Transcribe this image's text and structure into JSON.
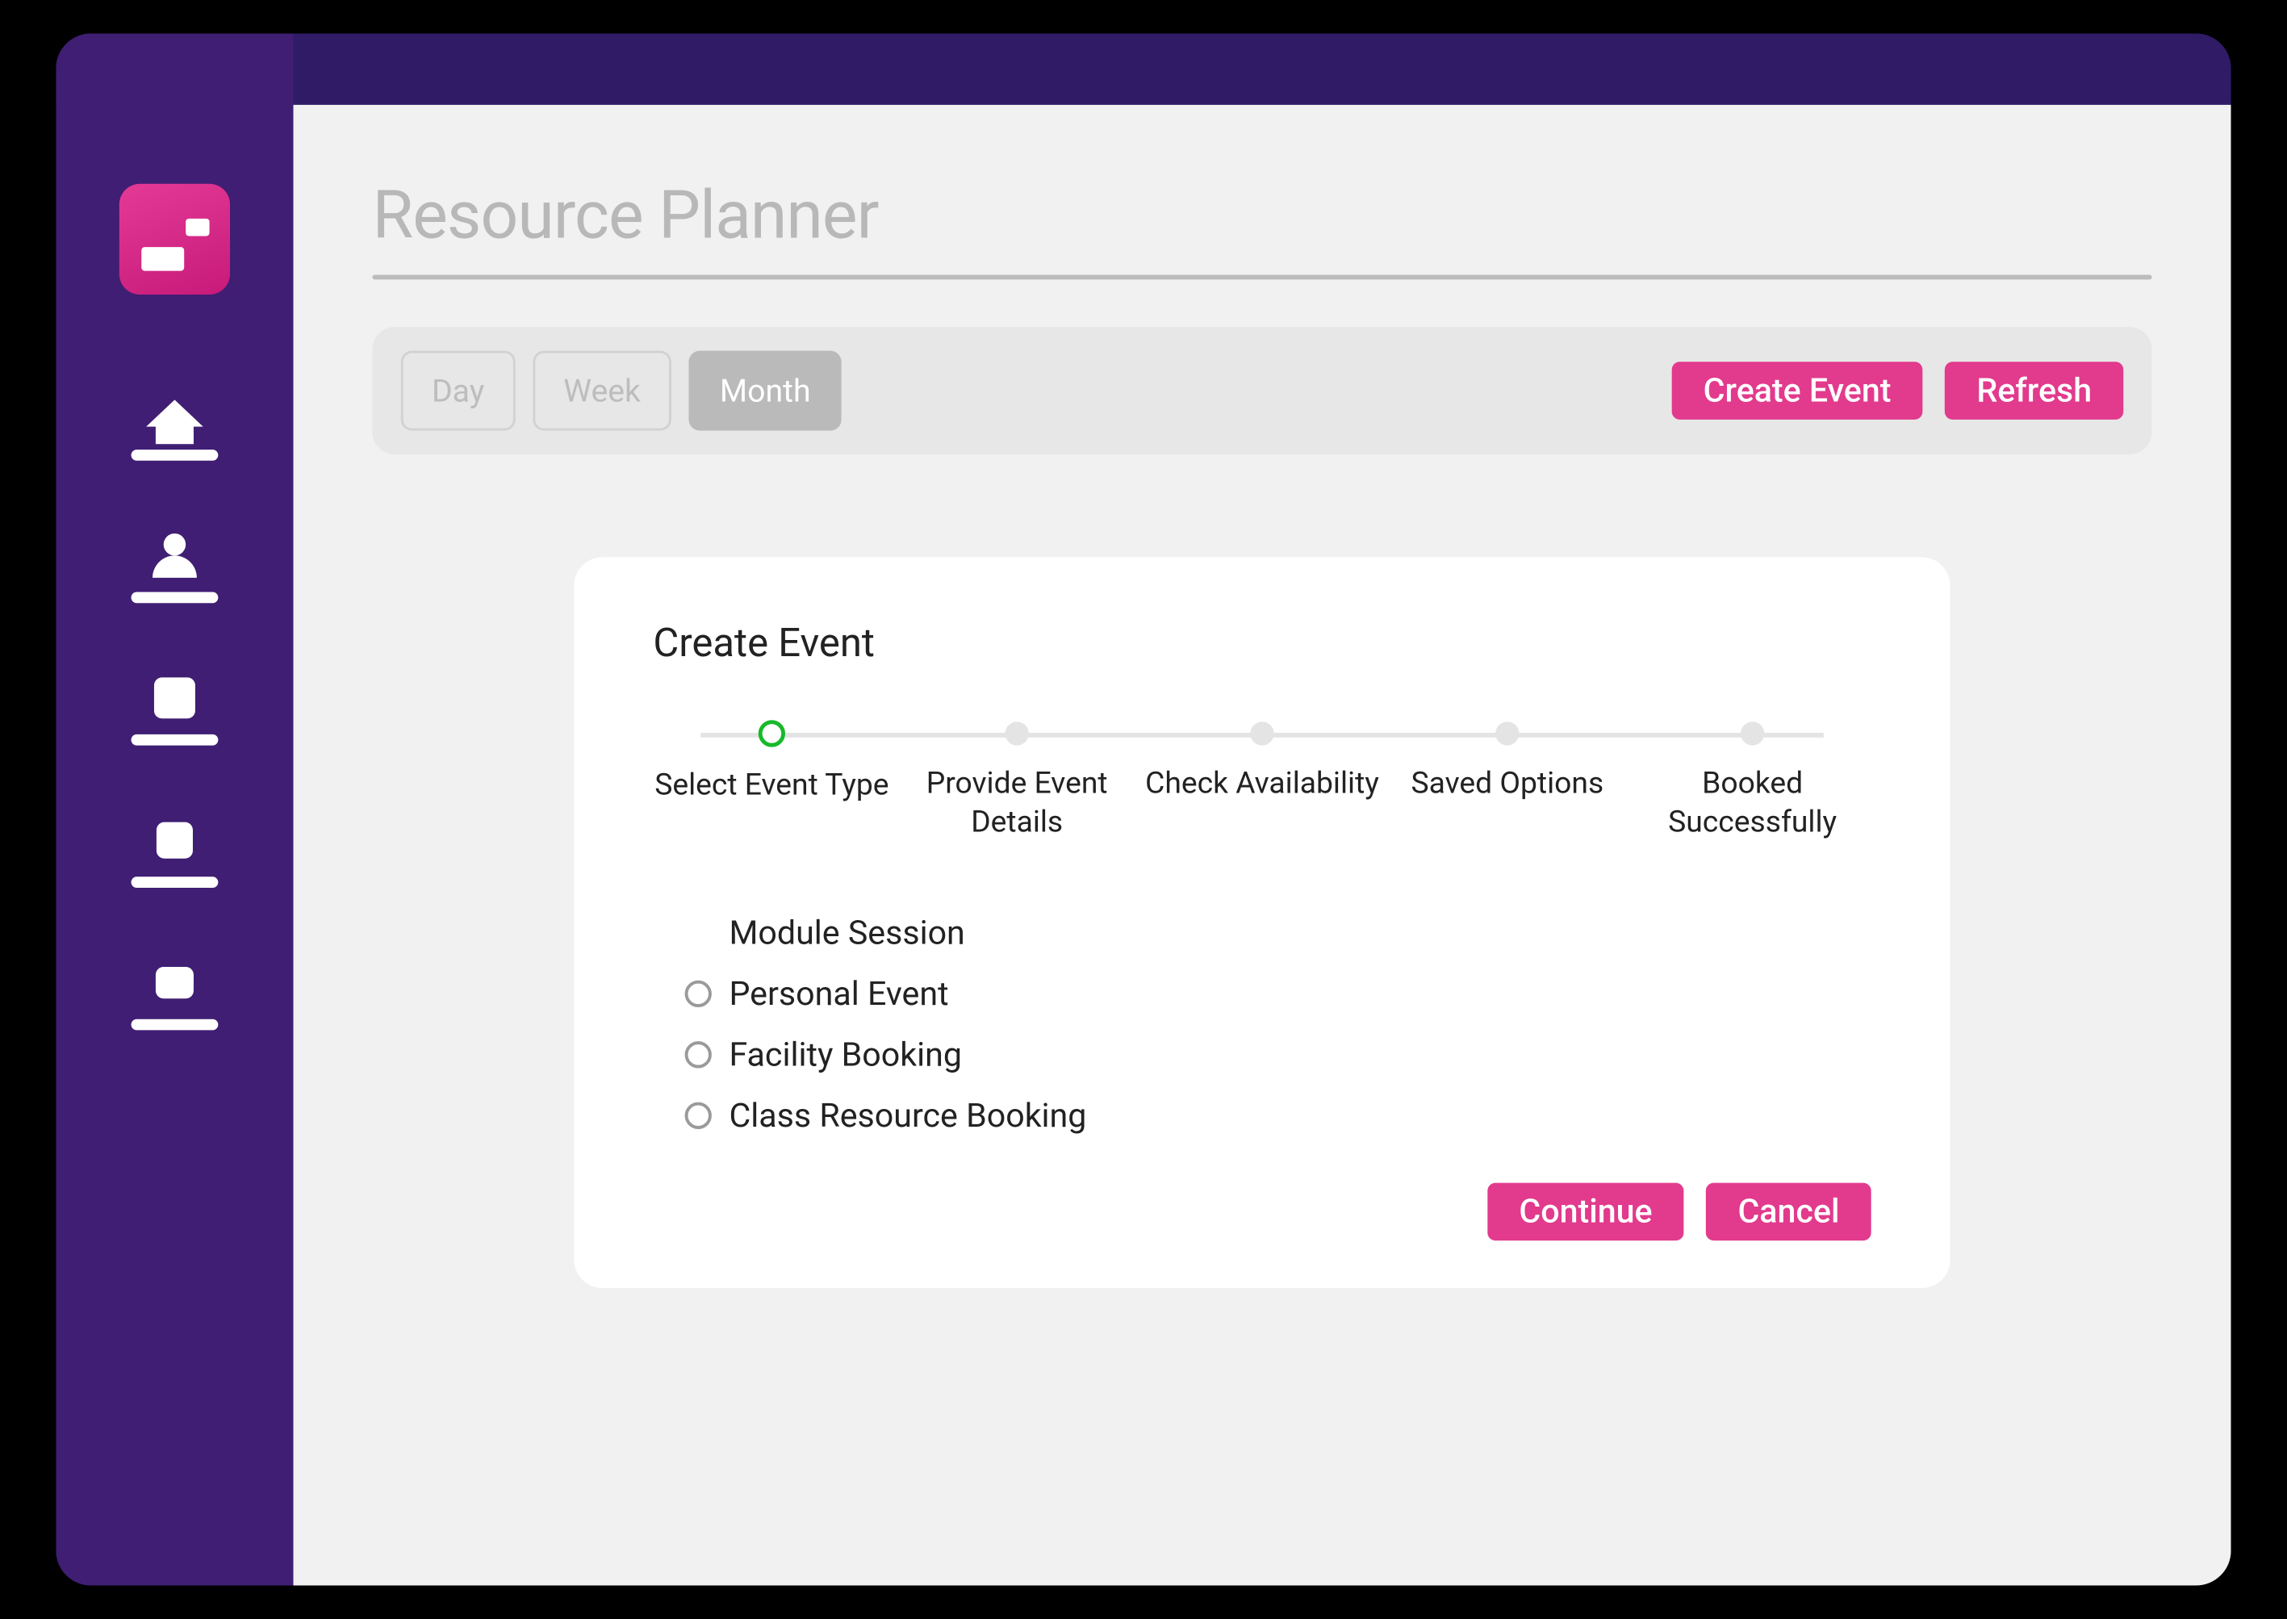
{
  "page": {
    "title": "Resource Planner"
  },
  "toolbar": {
    "views": {
      "day": "Day",
      "week": "Week",
      "month": "Month",
      "active": "month"
    },
    "create_event_label": "Create Event",
    "refresh_label": "Refresh"
  },
  "panel": {
    "title": "Create Event",
    "steps": [
      {
        "label": "Select Event Type",
        "active": true
      },
      {
        "label": "Provide Event Details",
        "active": false
      },
      {
        "label": "Check Availability",
        "active": false
      },
      {
        "label": "Saved Options",
        "active": false
      },
      {
        "label": "Booked Successfully",
        "active": false
      }
    ],
    "options_heading": "Module Session",
    "options": [
      "Personal Event",
      "Facility Booking",
      "Class Resource Booking"
    ],
    "continue_label": "Continue",
    "cancel_label": "Cancel"
  }
}
